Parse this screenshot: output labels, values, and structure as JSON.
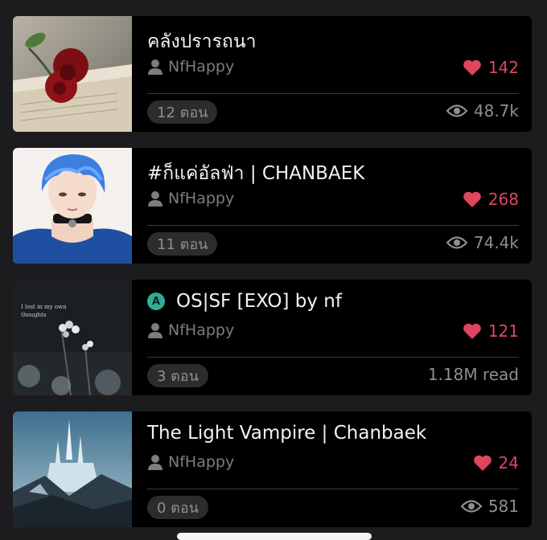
{
  "stories": [
    {
      "title": "คลังปรารถนา",
      "author": "NfHappy",
      "likes": "142",
      "chapters": "12 ตอน",
      "views": "48.7k",
      "cover_icon": "rose-on-book-cover"
    },
    {
      "title": "#ก็แค่อัลฟ่า | CHANBAEK",
      "author": "NfHappy",
      "likes": "268",
      "chapters": "11 ตอน",
      "views": "74.4k",
      "cover_icon": "blue-hair-character-cover"
    },
    {
      "badge": "A",
      "title": "OS|SF [EXO] by nf",
      "author": "NfHappy",
      "likes": "121",
      "chapters": "3 ตอน",
      "views": "1.18M read",
      "cover_text": "I lost in my own thoughts",
      "cover_icon": "white-flowers-cover"
    },
    {
      "title": "The Light Vampire | Chanbaek",
      "author": "NfHappy",
      "likes": "24",
      "chapters": "0 ตอน",
      "views": "581",
      "cover_icon": "ice-castle-cover"
    }
  ],
  "colors": {
    "background": "#1c1c1e",
    "card": "#000000",
    "like": "#e0455f",
    "badge": "#2fae95"
  }
}
